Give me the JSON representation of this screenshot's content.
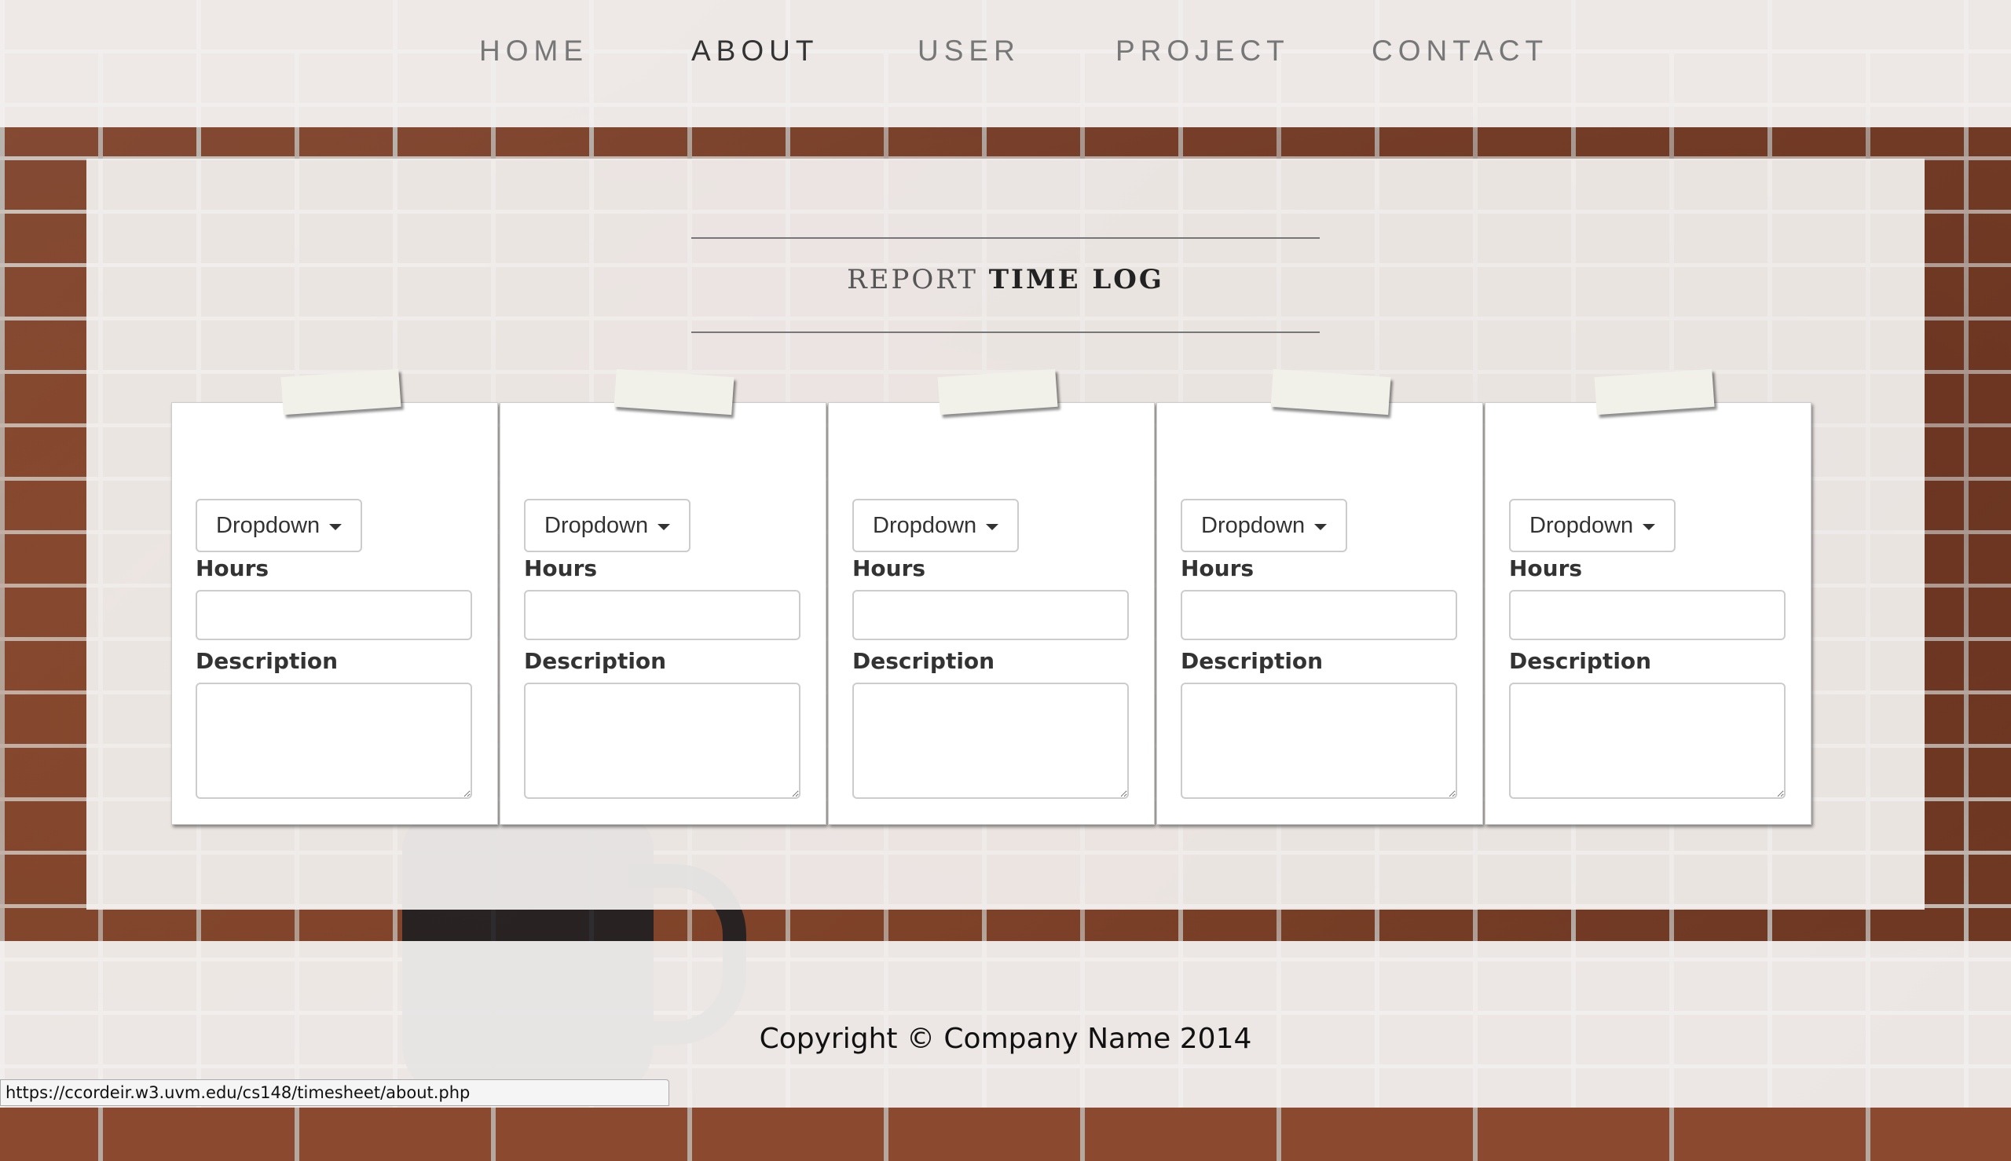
{
  "nav": {
    "items": [
      {
        "label": "HOME"
      },
      {
        "label": "ABOUT"
      },
      {
        "label": "USER"
      },
      {
        "label": "PROJECT"
      },
      {
        "label": "CONTACT"
      }
    ],
    "active": "ABOUT"
  },
  "report": {
    "title_prefix": "REPORT",
    "title_main": "TIME LOG"
  },
  "cards": [
    {
      "dropdown_label": "Dropdown",
      "hours_label": "Hours",
      "hours_value": "",
      "description_label": "Description",
      "description_value": ""
    },
    {
      "dropdown_label": "Dropdown",
      "hours_label": "Hours",
      "hours_value": "",
      "description_label": "Description",
      "description_value": ""
    },
    {
      "dropdown_label": "Dropdown",
      "hours_label": "Hours",
      "hours_value": "",
      "description_label": "Description",
      "description_value": ""
    },
    {
      "dropdown_label": "Dropdown",
      "hours_label": "Hours",
      "hours_value": "",
      "description_label": "Description",
      "description_value": ""
    },
    {
      "dropdown_label": "Dropdown",
      "hours_label": "Hours",
      "hours_value": "",
      "description_label": "Description",
      "description_value": ""
    }
  ],
  "footer": {
    "copyright": "Copyright © Company Name 2014"
  },
  "status_bar": {
    "url": "https://ccordeir.w3.uvm.edu/cs148/timesheet/about.php"
  },
  "colors": {
    "nav_text": "#777777",
    "nav_active": "#333333",
    "panel_bg": "#f3f1f0",
    "tape": "#f1f1e9"
  }
}
